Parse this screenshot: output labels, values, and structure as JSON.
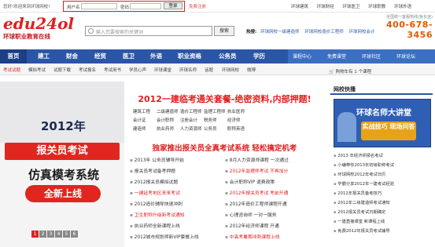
{
  "topbar": {
    "welcome": "您好!欢迎来到环球网校!",
    "username_label": "用户名",
    "password_label": "密码",
    "login_button": "登录",
    "free_register": "免费注册",
    "links": [
      "环球建筑",
      "环球财经",
      "环球医卫",
      "环球职教",
      "环球外语"
    ]
  },
  "header": {
    "logo_main": "edu24ol",
    "logo_sub": "环球职业教育在线",
    "search_placeholder": "输入您要搜索的关键词",
    "search_button": "搜索",
    "hot_label": "热搜:",
    "hot_items": [
      "环球网校一级建造师",
      "环球网校造价工程师",
      "环球网校会计"
    ],
    "phone_text": "全国统一客服热线(免长途)",
    "phone_number": "400-678-3456"
  },
  "nav": {
    "home": "首页",
    "items": [
      "建工",
      "财会",
      "经贸",
      "医卫",
      "外语",
      "职业资格",
      "公务员",
      "学历"
    ],
    "sub_items": [
      "课程中心",
      "免费课堂",
      "环球社区",
      "环球论坛"
    ]
  },
  "subnav": {
    "items": [
      "考试试题",
      "模拟考试",
      "试题下载",
      "考试报名",
      "考试用书",
      "学员心声",
      "环球课堂",
      "环球名师",
      "话题",
      "环球网校",
      "微博"
    ],
    "cart": "购物车有 1 个课程"
  },
  "banner": {
    "year": "2012年",
    "tag": "报关员考试",
    "headline": "仿真模考系统",
    "new_label": "全新上线",
    "pages": [
      "1",
      "2",
      "3",
      "4",
      "5",
      "6"
    ],
    "active_page": "1"
  },
  "center": {
    "title": "2012一建临考通关套餐-绝密资料,内部押题!",
    "quick_links_rows": [
      [
        "建筑工程",
        "二级建造师",
        "造价工程师",
        "监理工程师",
        "执业医师"
      ],
      [
        "会计证",
        "会计职称",
        "注册会计",
        "税务师",
        "经济师"
      ],
      [
        "建造师",
        "执业药师",
        "人力资源师",
        "公务员",
        "职称英语"
      ]
    ],
    "subtitle": "独家推出报关员全真考试系统 轻松搞定机考",
    "news_left": [
      "2013年 公务员辅导开始",
      "报关员考试备考押题",
      "2012报关员模拟试题",
      "一建延考地区来来考试",
      "2012造价辅导快速冲刺",
      "卫生职称升级新考试通知",
      "执业药师全新课程上线",
      "2012城市规划师新VIP套餐上线"
    ],
    "news_right": [
      "8月人力资源师课程 一次通过",
      "2012年监理师考试 不再加分",
      "会计职称VIP 退费政策",
      "2012年报关员考试 考前开通",
      "2012年造价工程师课程开通",
      "心理咨询师 一对一服务",
      "2012年经济师课程 开通",
      "中高考暑期冲刺课程上线"
    ]
  },
  "right": {
    "title": "网校快播",
    "image_text": "环球名师大讲堂",
    "image_badge": "实战技巧 现场问答",
    "items": [
      "2013 年经济师报名考试",
      "小编带你2013年初级职称考试",
      "环球网校2012年考试日历",
      "学霸分享2012年一建考试经验",
      "2012年报关员备考技巧",
      "2012年二级建造师考试通知",
      "2012报关员考试日期确定",
      "一建直播课堂 新课程上线",
      "免费2012年报关员考试辅导"
    ]
  }
}
